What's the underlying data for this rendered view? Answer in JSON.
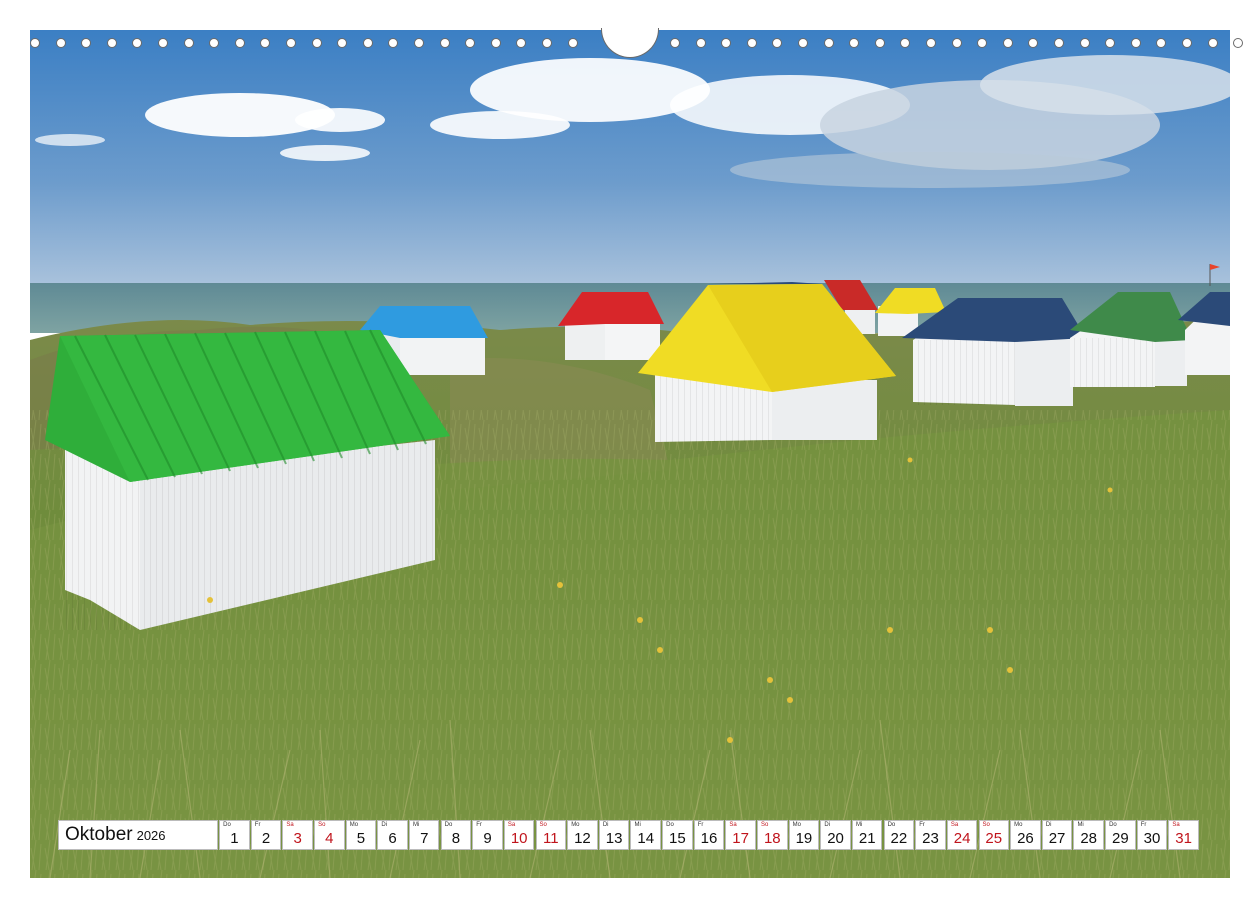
{
  "calendar": {
    "month": "Oktober",
    "year": "2026",
    "days": [
      {
        "wd": "Do",
        "n": "1",
        "we": false
      },
      {
        "wd": "Fr",
        "n": "2",
        "we": false
      },
      {
        "wd": "Sa",
        "n": "3",
        "we": true
      },
      {
        "wd": "So",
        "n": "4",
        "we": true
      },
      {
        "wd": "Mo",
        "n": "5",
        "we": false
      },
      {
        "wd": "Di",
        "n": "6",
        "we": false
      },
      {
        "wd": "Mi",
        "n": "7",
        "we": false
      },
      {
        "wd": "Do",
        "n": "8",
        "we": false
      },
      {
        "wd": "Fr",
        "n": "9",
        "we": false
      },
      {
        "wd": "Sa",
        "n": "10",
        "we": true
      },
      {
        "wd": "So",
        "n": "11",
        "we": true
      },
      {
        "wd": "Mo",
        "n": "12",
        "we": false
      },
      {
        "wd": "Di",
        "n": "13",
        "we": false
      },
      {
        "wd": "Mi",
        "n": "14",
        "we": false
      },
      {
        "wd": "Do",
        "n": "15",
        "we": false
      },
      {
        "wd": "Fr",
        "n": "16",
        "we": false
      },
      {
        "wd": "Sa",
        "n": "17",
        "we": true
      },
      {
        "wd": "So",
        "n": "18",
        "we": true
      },
      {
        "wd": "Mo",
        "n": "19",
        "we": false
      },
      {
        "wd": "Di",
        "n": "20",
        "we": false
      },
      {
        "wd": "Mi",
        "n": "21",
        "we": false
      },
      {
        "wd": "Do",
        "n": "22",
        "we": false
      },
      {
        "wd": "Fr",
        "n": "23",
        "we": false
      },
      {
        "wd": "Sa",
        "n": "24",
        "we": true
      },
      {
        "wd": "So",
        "n": "25",
        "we": true
      },
      {
        "wd": "Mo",
        "n": "26",
        "we": false
      },
      {
        "wd": "Di",
        "n": "27",
        "we": false
      },
      {
        "wd": "Mi",
        "n": "28",
        "we": false
      },
      {
        "wd": "Do",
        "n": "29",
        "we": false
      },
      {
        "wd": "Fr",
        "n": "30",
        "we": false
      },
      {
        "wd": "Sa",
        "n": "31",
        "we": true
      }
    ]
  },
  "colors": {
    "weekend": "#c0141c",
    "roof_green": "#2fae3a",
    "roof_blue": "#2f9be0",
    "roof_red": "#d8262a",
    "roof_yellow": "#f0dc24",
    "roof_navy": "#2b4a78",
    "roof_darkgreen": "#3f8a4a"
  }
}
